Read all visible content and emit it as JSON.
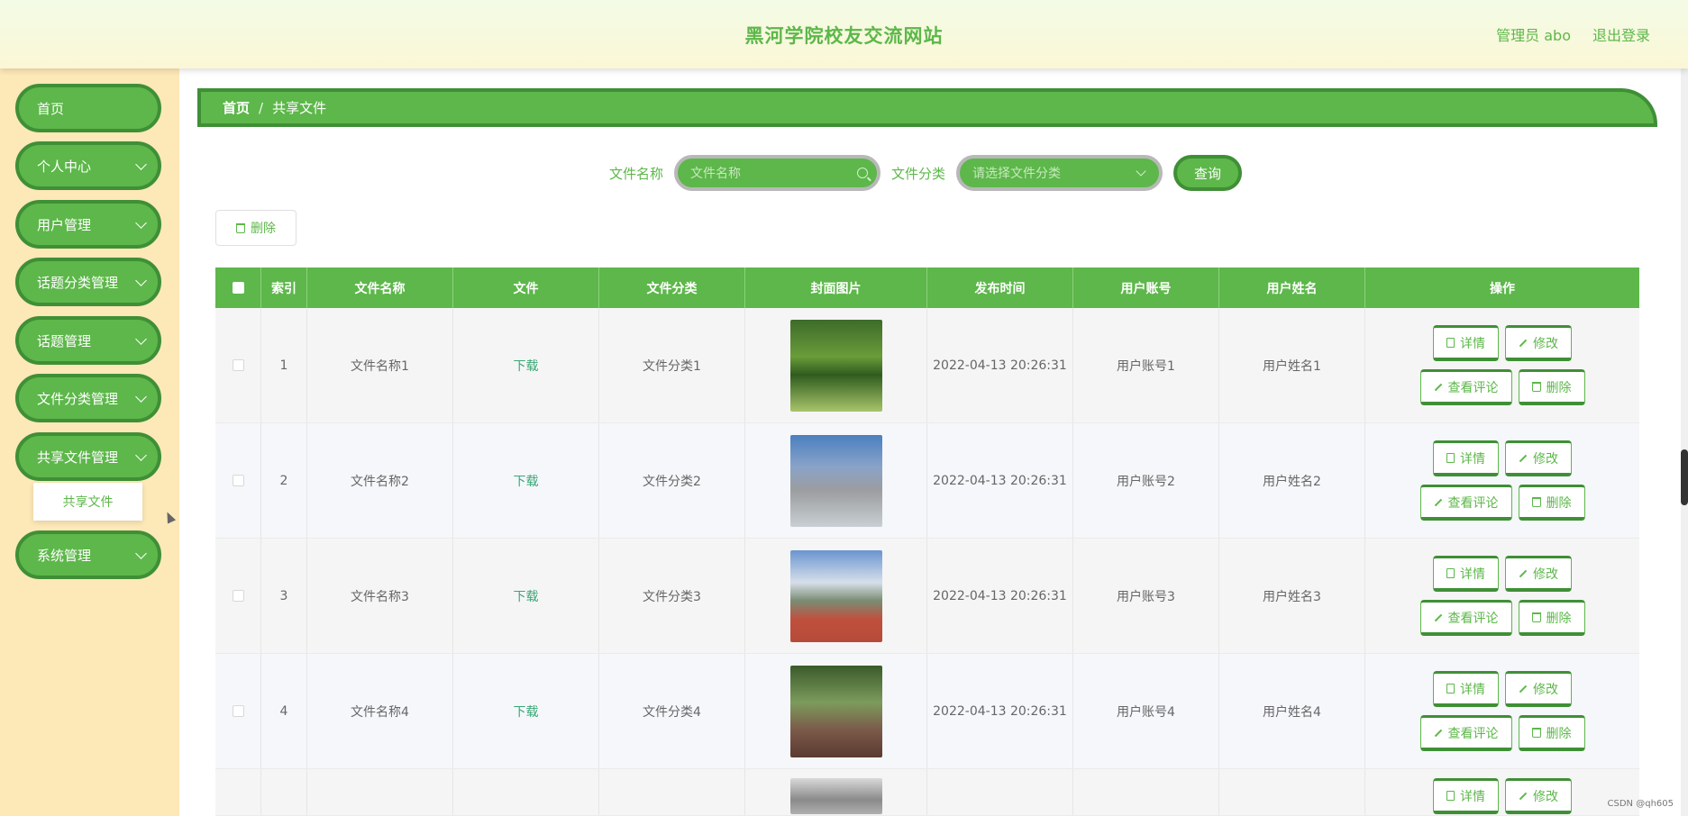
{
  "header": {
    "site_title": "黑河学院校友交流网站",
    "admin_label": "管理员 abo",
    "logout_label": "退出登录"
  },
  "sidebar": {
    "items": [
      {
        "label": "首页",
        "has_chevron": false
      },
      {
        "label": "个人中心",
        "has_chevron": true
      },
      {
        "label": "用户管理",
        "has_chevron": true
      },
      {
        "label": "话题分类管理",
        "has_chevron": true
      },
      {
        "label": "话题管理",
        "has_chevron": true
      },
      {
        "label": "文件分类管理",
        "has_chevron": true
      },
      {
        "label": "共享文件管理",
        "has_chevron": true
      },
      {
        "label": "系统管理",
        "has_chevron": true
      }
    ],
    "submenu_label": "共享文件"
  },
  "breadcrumb": {
    "home": "首页",
    "separator": "/",
    "current": "共享文件"
  },
  "search": {
    "name_label": "文件名称",
    "name_placeholder": "文件名称",
    "category_label": "文件分类",
    "category_placeholder": "请选择文件分类",
    "query_label": "查询"
  },
  "toolbar": {
    "delete_label": "删除"
  },
  "table": {
    "headers": [
      "索引",
      "文件名称",
      "文件",
      "文件分类",
      "封面图片",
      "发布时间",
      "用户账号",
      "用户姓名",
      "操作"
    ],
    "rows": [
      {
        "index": "1",
        "name": "文件名称1",
        "file": "下载",
        "category": "文件分类1",
        "time": "2022-04-13 20:26:31",
        "account": "用户账号1",
        "username": "用户姓名1"
      },
      {
        "index": "2",
        "name": "文件名称2",
        "file": "下载",
        "category": "文件分类2",
        "time": "2022-04-13 20:26:31",
        "account": "用户账号2",
        "username": "用户姓名2"
      },
      {
        "index": "3",
        "name": "文件名称3",
        "file": "下载",
        "category": "文件分类3",
        "time": "2022-04-13 20:26:31",
        "account": "用户账号3",
        "username": "用户姓名3"
      },
      {
        "index": "4",
        "name": "文件名称4",
        "file": "下载",
        "category": "文件分类4",
        "time": "2022-04-13 20:26:31",
        "account": "用户账号4",
        "username": "用户姓名4"
      }
    ],
    "actions": {
      "detail": "详情",
      "edit": "修改",
      "comments": "查看评论",
      "delete": "删除"
    }
  },
  "colors": {
    "primary": "#5db74a",
    "primary_dark": "#3f8f36",
    "sidebar_bg": "#fde8b8",
    "header_bg": "#f3fbe6",
    "download_link": "#3aa676"
  },
  "watermark": "CSDN @qh605"
}
